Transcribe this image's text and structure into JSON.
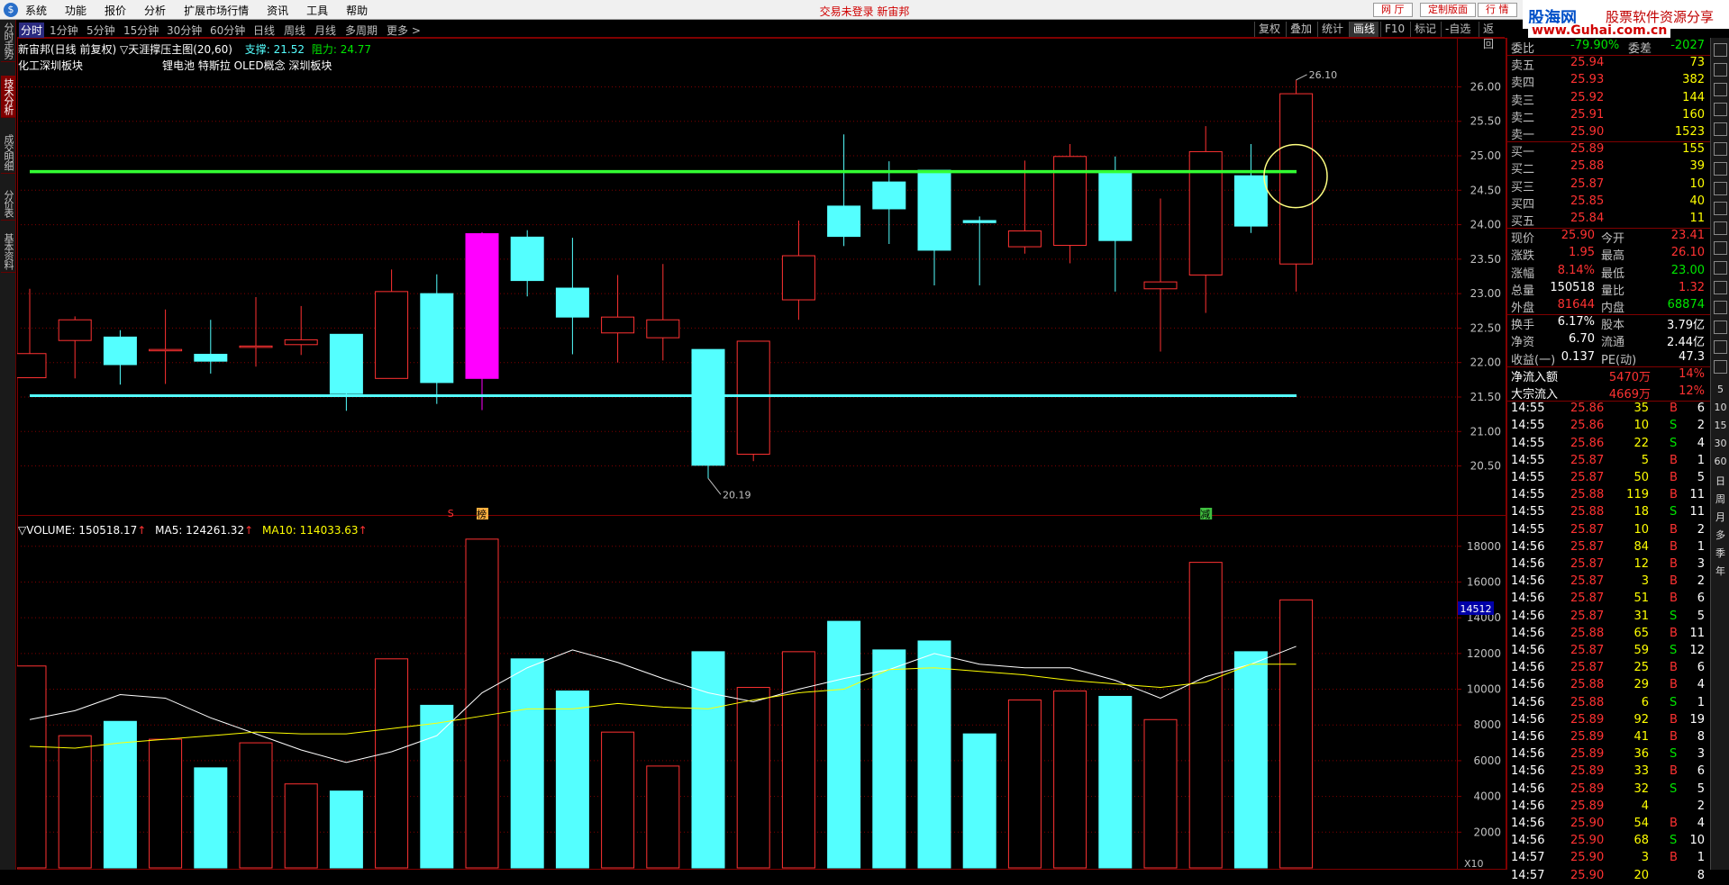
{
  "menu": {
    "items": [
      "系统",
      "功能",
      "报价",
      "分析",
      "扩展市场行情",
      "资讯",
      "工具",
      "帮助"
    ],
    "center_text": "交易未登录  新宙邦",
    "right_buttons": [
      "网 厅",
      "定制版面",
      "行 情"
    ]
  },
  "watermark": {
    "brand": "股海网",
    "slogan": "股票软件资源分享",
    "url": "www.Guhai.com.cn"
  },
  "period_bar": {
    "items": [
      "分时",
      "1分钟",
      "5分钟",
      "15分钟",
      "30分钟",
      "60分钟",
      "日线",
      "周线",
      "月线",
      "多周期",
      "更多 >"
    ],
    "active": "分时",
    "tools": [
      "复权",
      "叠加",
      "统计",
      "画线",
      "F10",
      "标记",
      "-自选",
      "返回"
    ],
    "active_tool": "画线"
  },
  "left_tabs": [
    "分时走势",
    "技术分析",
    "成交明细",
    "分价表",
    "基本资料"
  ],
  "left_tab_active": "技术分析",
  "chart_header": {
    "line1_name": "新宙邦(日线 前复权)",
    "line1_indicator": "▽天涯撑压主图(20,60)",
    "support_label": "支撑: 21.52",
    "resist_label": "阻力: 24.77",
    "line2_left": "化工深圳板块",
    "line2_right": "锂电池 特斯拉 OLED概念 深圳板块"
  },
  "volume_header": {
    "volume": "▽VOLUME: 150518.17",
    "ma5": "MA5: 124261.32",
    "ma10": "MA10: 114033.63"
  },
  "volume_badge": "14512",
  "multiplier_label": "X10",
  "annotations": {
    "high": "26.10",
    "low": "20.19",
    "mark1": "S",
    "mark2": "榜",
    "mark3": "减"
  },
  "chart_data": {
    "type": "candlestick",
    "price_axis": {
      "ticks": [
        "26.00",
        "25.50",
        "25.00",
        "24.50",
        "24.00",
        "23.50",
        "23.00",
        "22.50",
        "22.00",
        "21.50",
        "21.00",
        "20.50"
      ],
      "range": [
        20.05,
        26.45
      ]
    },
    "volume_axis": {
      "ticks": [
        "18000",
        "16000",
        "14000",
        "12000",
        "10000",
        "8000",
        "6000",
        "4000",
        "2000"
      ],
      "range": [
        0,
        19500
      ]
    },
    "support": 21.52,
    "resistance": 24.77,
    "candles": [
      {
        "o": 21.78,
        "h": 23.07,
        "l": 21.78,
        "c": 22.13,
        "v": 11300,
        "color": "red"
      },
      {
        "o": 22.32,
        "h": 22.67,
        "l": 21.77,
        "c": 22.62,
        "v": 7400,
        "color": "red"
      },
      {
        "o": 22.37,
        "h": 22.47,
        "l": 21.68,
        "c": 21.97,
        "v": 8200,
        "color": "cyan"
      },
      {
        "o": 22.17,
        "h": 22.77,
        "l": 21.69,
        "c": 22.19,
        "v": 7200,
        "color": "red"
      },
      {
        "o": 22.12,
        "h": 22.62,
        "l": 21.84,
        "c": 22.02,
        "v": 5600,
        "color": "cyan"
      },
      {
        "o": 22.22,
        "h": 22.95,
        "l": 21.94,
        "c": 22.24,
        "v": 7000,
        "color": "red"
      },
      {
        "o": 22.26,
        "h": 22.82,
        "l": 22.11,
        "c": 22.33,
        "v": 4700,
        "color": "red"
      },
      {
        "o": 22.41,
        "h": 22.41,
        "l": 21.3,
        "c": 21.55,
        "v": 4300,
        "color": "cyan"
      },
      {
        "o": 21.77,
        "h": 23.35,
        "l": 21.77,
        "c": 23.03,
        "v": 11700,
        "color": "red"
      },
      {
        "o": 23.0,
        "h": 23.28,
        "l": 21.4,
        "c": 21.71,
        "v": 9100,
        "color": "cyan"
      },
      {
        "o": 21.77,
        "h": 23.89,
        "l": 21.31,
        "c": 23.87,
        "v": 18400,
        "color": "magenta"
      },
      {
        "o": 23.82,
        "h": 23.92,
        "l": 22.96,
        "c": 23.19,
        "v": 11700,
        "color": "cyan"
      },
      {
        "o": 23.08,
        "h": 23.81,
        "l": 22.12,
        "c": 22.66,
        "v": 9900,
        "color": "cyan"
      },
      {
        "o": 22.43,
        "h": 23.27,
        "l": 22.0,
        "c": 22.66,
        "v": 7600,
        "color": "red"
      },
      {
        "o": 22.62,
        "h": 23.43,
        "l": 22.03,
        "c": 22.36,
        "v": 5700,
        "color": "red"
      },
      {
        "o": 22.19,
        "h": 22.19,
        "l": 20.32,
        "c": 20.51,
        "v": 12100,
        "color": "cyan"
      },
      {
        "o": 20.67,
        "h": 22.31,
        "l": 20.57,
        "c": 22.31,
        "v": 10100,
        "color": "red"
      },
      {
        "o": 22.91,
        "h": 24.06,
        "l": 22.62,
        "c": 23.55,
        "v": 12100,
        "color": "red"
      },
      {
        "o": 24.27,
        "h": 25.31,
        "l": 23.69,
        "c": 23.83,
        "v": 13800,
        "color": "cyan"
      },
      {
        "o": 24.62,
        "h": 24.92,
        "l": 23.72,
        "c": 24.23,
        "v": 12200,
        "color": "cyan"
      },
      {
        "o": 24.79,
        "h": 24.79,
        "l": 23.12,
        "c": 23.63,
        "v": 12700,
        "color": "cyan"
      },
      {
        "o": 24.06,
        "h": 24.12,
        "l": 23.12,
        "c": 24.03,
        "v": 7500,
        "color": "cyan"
      },
      {
        "o": 23.91,
        "h": 24.93,
        "l": 23.58,
        "c": 23.68,
        "v": 9400,
        "color": "red"
      },
      {
        "o": 23.7,
        "h": 25.17,
        "l": 23.44,
        "c": 24.99,
        "v": 9900,
        "color": "red"
      },
      {
        "o": 24.78,
        "h": 24.99,
        "l": 23.03,
        "c": 23.77,
        "v": 9600,
        "color": "cyan"
      },
      {
        "o": 23.17,
        "h": 24.38,
        "l": 22.16,
        "c": 23.07,
        "v": 8300,
        "color": "red"
      },
      {
        "o": 23.27,
        "h": 25.43,
        "l": 22.72,
        "c": 25.06,
        "v": 17100,
        "color": "red"
      },
      {
        "o": 24.71,
        "h": 25.17,
        "l": 23.88,
        "c": 23.98,
        "v": 12100,
        "color": "cyan"
      },
      {
        "o": 23.43,
        "h": 26.1,
        "l": 23.03,
        "c": 25.9,
        "v": 15000,
        "color": "red"
      }
    ],
    "ma5": [
      8300,
      8800,
      9700,
      9500,
      8400,
      7500,
      6600,
      5900,
      6500,
      7400,
      9800,
      11200,
      12200,
      11500,
      10600,
      9800,
      9300,
      10000,
      10600,
      11100,
      12000,
      11400,
      11200,
      11200,
      10500,
      9500,
      10700,
      11400,
      12400
    ],
    "ma10": [
      6800,
      6700,
      7000,
      7200,
      7400,
      7600,
      7500,
      7500,
      7800,
      8100,
      8500,
      8900,
      8900,
      9200,
      9000,
      8900,
      9400,
      9800,
      10000,
      11100,
      11200,
      11000,
      10800,
      10500,
      10300,
      10100,
      10400,
      11400,
      11400
    ]
  },
  "quote": {
    "webi": {
      "label": "委比",
      "value": "-79.90%",
      "label2": "委差",
      "value2": "-2027"
    },
    "asks": [
      {
        "label": "卖五",
        "price": "25.94",
        "vol": "73"
      },
      {
        "label": "卖四",
        "price": "25.93",
        "vol": "382"
      },
      {
        "label": "卖三",
        "price": "25.92",
        "vol": "144"
      },
      {
        "label": "卖二",
        "price": "25.91",
        "vol": "160"
      },
      {
        "label": "卖一",
        "price": "25.90",
        "vol": "1523"
      }
    ],
    "bids": [
      {
        "label": "买一",
        "price": "25.89",
        "vol": "155"
      },
      {
        "label": "买二",
        "price": "25.88",
        "vol": "39"
      },
      {
        "label": "买三",
        "price": "25.87",
        "vol": "10"
      },
      {
        "label": "买四",
        "price": "25.85",
        "vol": "40"
      },
      {
        "label": "买五",
        "price": "25.84",
        "vol": "11"
      }
    ],
    "stats": [
      {
        "l1": "现价",
        "v1": "25.90",
        "c1": "red",
        "l2": "今开",
        "v2": "23.41",
        "c2": "red"
      },
      {
        "l1": "涨跌",
        "v1": "1.95",
        "c1": "red",
        "l2": "最高",
        "v2": "26.10",
        "c2": "red"
      },
      {
        "l1": "涨幅",
        "v1": "8.14%",
        "c1": "red",
        "l2": "最低",
        "v2": "23.00",
        "c2": "green"
      },
      {
        "l1": "总量",
        "v1": "150518",
        "c1": "white",
        "l2": "量比",
        "v2": "1.32",
        "c2": "red"
      },
      {
        "l1": "外盘",
        "v1": "81644",
        "c1": "red",
        "l2": "内盘",
        "v2": "68874",
        "c2": "green"
      }
    ],
    "stats2": [
      {
        "l1": "换手",
        "v1": "6.17%",
        "l2": "股本",
        "v2": "3.79亿"
      },
      {
        "l1": "净资",
        "v1": "6.70",
        "l2": "流通",
        "v2": "2.44亿"
      },
      {
        "l1": "收益(一)",
        "v1": "0.137",
        "l2": "PE(动)",
        "v2": "47.3"
      }
    ],
    "flows": [
      {
        "label": "净流入额",
        "value": "5470万",
        "pct": "14%"
      },
      {
        "label": "大宗流入",
        "value": "4669万",
        "pct": "12%"
      }
    ],
    "ticks": [
      {
        "t": "14:55",
        "p": "25.86",
        "v": "35",
        "s": "B",
        "n": "6"
      },
      {
        "t": "14:55",
        "p": "25.86",
        "v": "10",
        "s": "S",
        "n": "2"
      },
      {
        "t": "14:55",
        "p": "25.86",
        "v": "22",
        "s": "S",
        "n": "4"
      },
      {
        "t": "14:55",
        "p": "25.87",
        "v": "5",
        "s": "B",
        "n": "1"
      },
      {
        "t": "14:55",
        "p": "25.87",
        "v": "50",
        "s": "B",
        "n": "5"
      },
      {
        "t": "14:55",
        "p": "25.88",
        "v": "119",
        "s": "B",
        "n": "11"
      },
      {
        "t": "14:55",
        "p": "25.88",
        "v": "18",
        "s": "S",
        "n": "11"
      },
      {
        "t": "14:55",
        "p": "25.87",
        "v": "10",
        "s": "B",
        "n": "2"
      },
      {
        "t": "14:56",
        "p": "25.87",
        "v": "84",
        "s": "B",
        "n": "1"
      },
      {
        "t": "14:56",
        "p": "25.87",
        "v": "12",
        "s": "B",
        "n": "3"
      },
      {
        "t": "14:56",
        "p": "25.87",
        "v": "3",
        "s": "B",
        "n": "2"
      },
      {
        "t": "14:56",
        "p": "25.87",
        "v": "51",
        "s": "B",
        "n": "6"
      },
      {
        "t": "14:56",
        "p": "25.87",
        "v": "31",
        "s": "S",
        "n": "5"
      },
      {
        "t": "14:56",
        "p": "25.88",
        "v": "65",
        "s": "B",
        "n": "11"
      },
      {
        "t": "14:56",
        "p": "25.87",
        "v": "59",
        "s": "S",
        "n": "12"
      },
      {
        "t": "14:56",
        "p": "25.87",
        "v": "25",
        "s": "B",
        "n": "6"
      },
      {
        "t": "14:56",
        "p": "25.88",
        "v": "29",
        "s": "B",
        "n": "4"
      },
      {
        "t": "14:56",
        "p": "25.88",
        "v": "6",
        "s": "S",
        "n": "1"
      },
      {
        "t": "14:56",
        "p": "25.89",
        "v": "92",
        "s": "B",
        "n": "19"
      },
      {
        "t": "14:56",
        "p": "25.89",
        "v": "41",
        "s": "B",
        "n": "8"
      },
      {
        "t": "14:56",
        "p": "25.89",
        "v": "36",
        "s": "S",
        "n": "3"
      },
      {
        "t": "14:56",
        "p": "25.89",
        "v": "33",
        "s": "B",
        "n": "6"
      },
      {
        "t": "14:56",
        "p": "25.89",
        "v": "32",
        "s": "S",
        "n": "5"
      },
      {
        "t": "14:56",
        "p": "25.89",
        "v": "4",
        "s": "",
        "n": "2"
      },
      {
        "t": "14:56",
        "p": "25.90",
        "v": "54",
        "s": "B",
        "n": "4"
      },
      {
        "t": "14:56",
        "p": "25.90",
        "v": "68",
        "s": "S",
        "n": "10"
      },
      {
        "t": "14:57",
        "p": "25.90",
        "v": "3",
        "s": "B",
        "n": "1"
      },
      {
        "t": "14:57",
        "p": "25.90",
        "v": "20",
        "s": "",
        "n": "8"
      }
    ]
  },
  "right_tools": [
    "5",
    "10",
    "15",
    "30",
    "60",
    "日",
    "周",
    "月",
    "多",
    "季",
    "年"
  ]
}
